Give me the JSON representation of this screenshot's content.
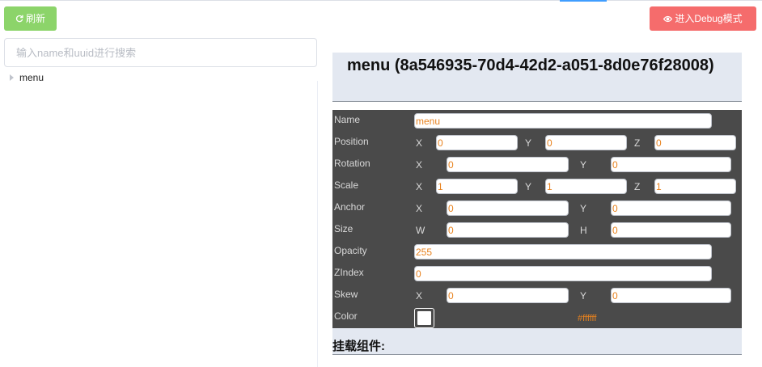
{
  "toolbar": {
    "refresh_label": "刷新",
    "debug_label": "进入Debug模式",
    "refresh_color": "#8cd46a",
    "debug_color": "#f56c6c"
  },
  "search": {
    "placeholder": "输入name和uuid进行搜索",
    "value": ""
  },
  "tree": {
    "items": [
      {
        "label": "menu"
      }
    ]
  },
  "node": {
    "title": "menu (8a546935-70d4-42d2-a051-8d0e76f28008)",
    "props": {
      "name": {
        "label": "Name",
        "value": "menu"
      },
      "position": {
        "label": "Position",
        "x_label": "X",
        "x": "0",
        "y_label": "Y",
        "y": "0",
        "z_label": "Z",
        "z": "0"
      },
      "rotation": {
        "label": "Rotation",
        "x_label": "X",
        "x": "0",
        "y_label": "Y",
        "y": "0"
      },
      "scale": {
        "label": "Scale",
        "x_label": "X",
        "x": "1",
        "y_label": "Y",
        "y": "1",
        "z_label": "Z",
        "z": "1"
      },
      "anchor": {
        "label": "Anchor",
        "x_label": "X",
        "x": "0",
        "y_label": "Y",
        "y": "0"
      },
      "size": {
        "label": "Size",
        "w_label": "W",
        "w": "0",
        "h_label": "H",
        "h": "0"
      },
      "opacity": {
        "label": "Opacity",
        "value": "255"
      },
      "zindex": {
        "label": "ZIndex",
        "value": "0"
      },
      "skew": {
        "label": "Skew",
        "x_label": "X",
        "x": "0",
        "y_label": "Y",
        "y": "0"
      },
      "color": {
        "label": "Color",
        "hex": "#ffffff"
      }
    },
    "components_title": "挂载组件:"
  }
}
